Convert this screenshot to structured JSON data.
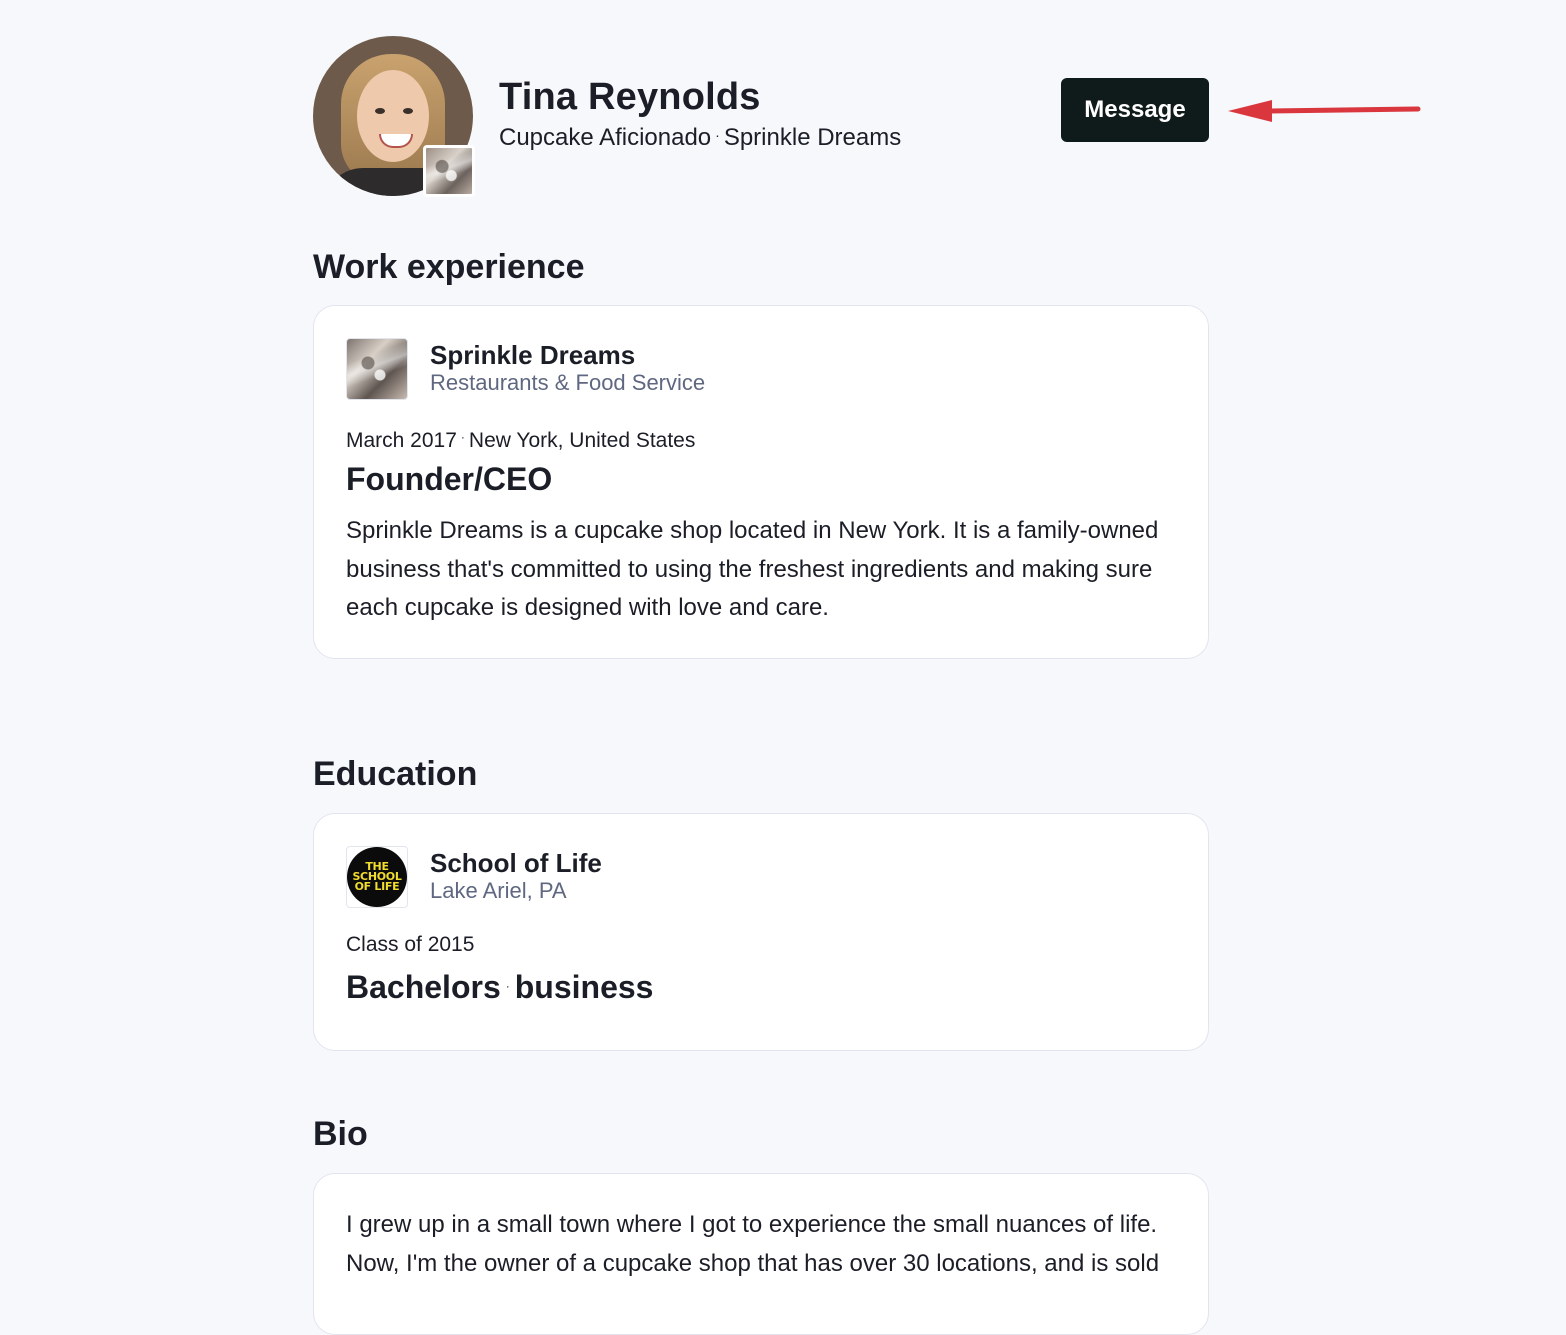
{
  "profile": {
    "name": "Tina Reynolds",
    "headline": "Cupcake Aficionado",
    "company": "Sprinkle Dreams",
    "separator": "·",
    "message_label": "Message"
  },
  "work_experience": {
    "title": "Work experience",
    "items": [
      {
        "org": "Sprinkle Dreams",
        "industry": "Restaurants & Food Service",
        "date": "March 2017",
        "location": "New York, United States",
        "role": "Founder/CEO",
        "description": "Sprinkle Dreams is a cupcake shop located in New York. It is a family-owned business that's committed to using the freshest ingredients and making sure each cupcake is designed with love and care."
      }
    ]
  },
  "education": {
    "title": "Education",
    "items": [
      {
        "school": "School of Life",
        "location": "Lake Ariel, PA",
        "class_of": "Class of 2015",
        "degree": "Bachelors",
        "field": "business",
        "logo_text": [
          "THE",
          "SCHOOL",
          "OF LIFE"
        ]
      }
    ]
  },
  "bio": {
    "title": "Bio",
    "text": "I grew up in a small town where I got to experience the small nuances of life. Now, I'm the owner of a cupcake shop that has over 30 locations, and is sold"
  },
  "colors": {
    "background": "#f7f8fc",
    "button": "#0f1b1b",
    "arrow": "#d9363e",
    "muted_text": "#5f6880"
  },
  "icons": {
    "annotation": "red-arrow-icon"
  }
}
